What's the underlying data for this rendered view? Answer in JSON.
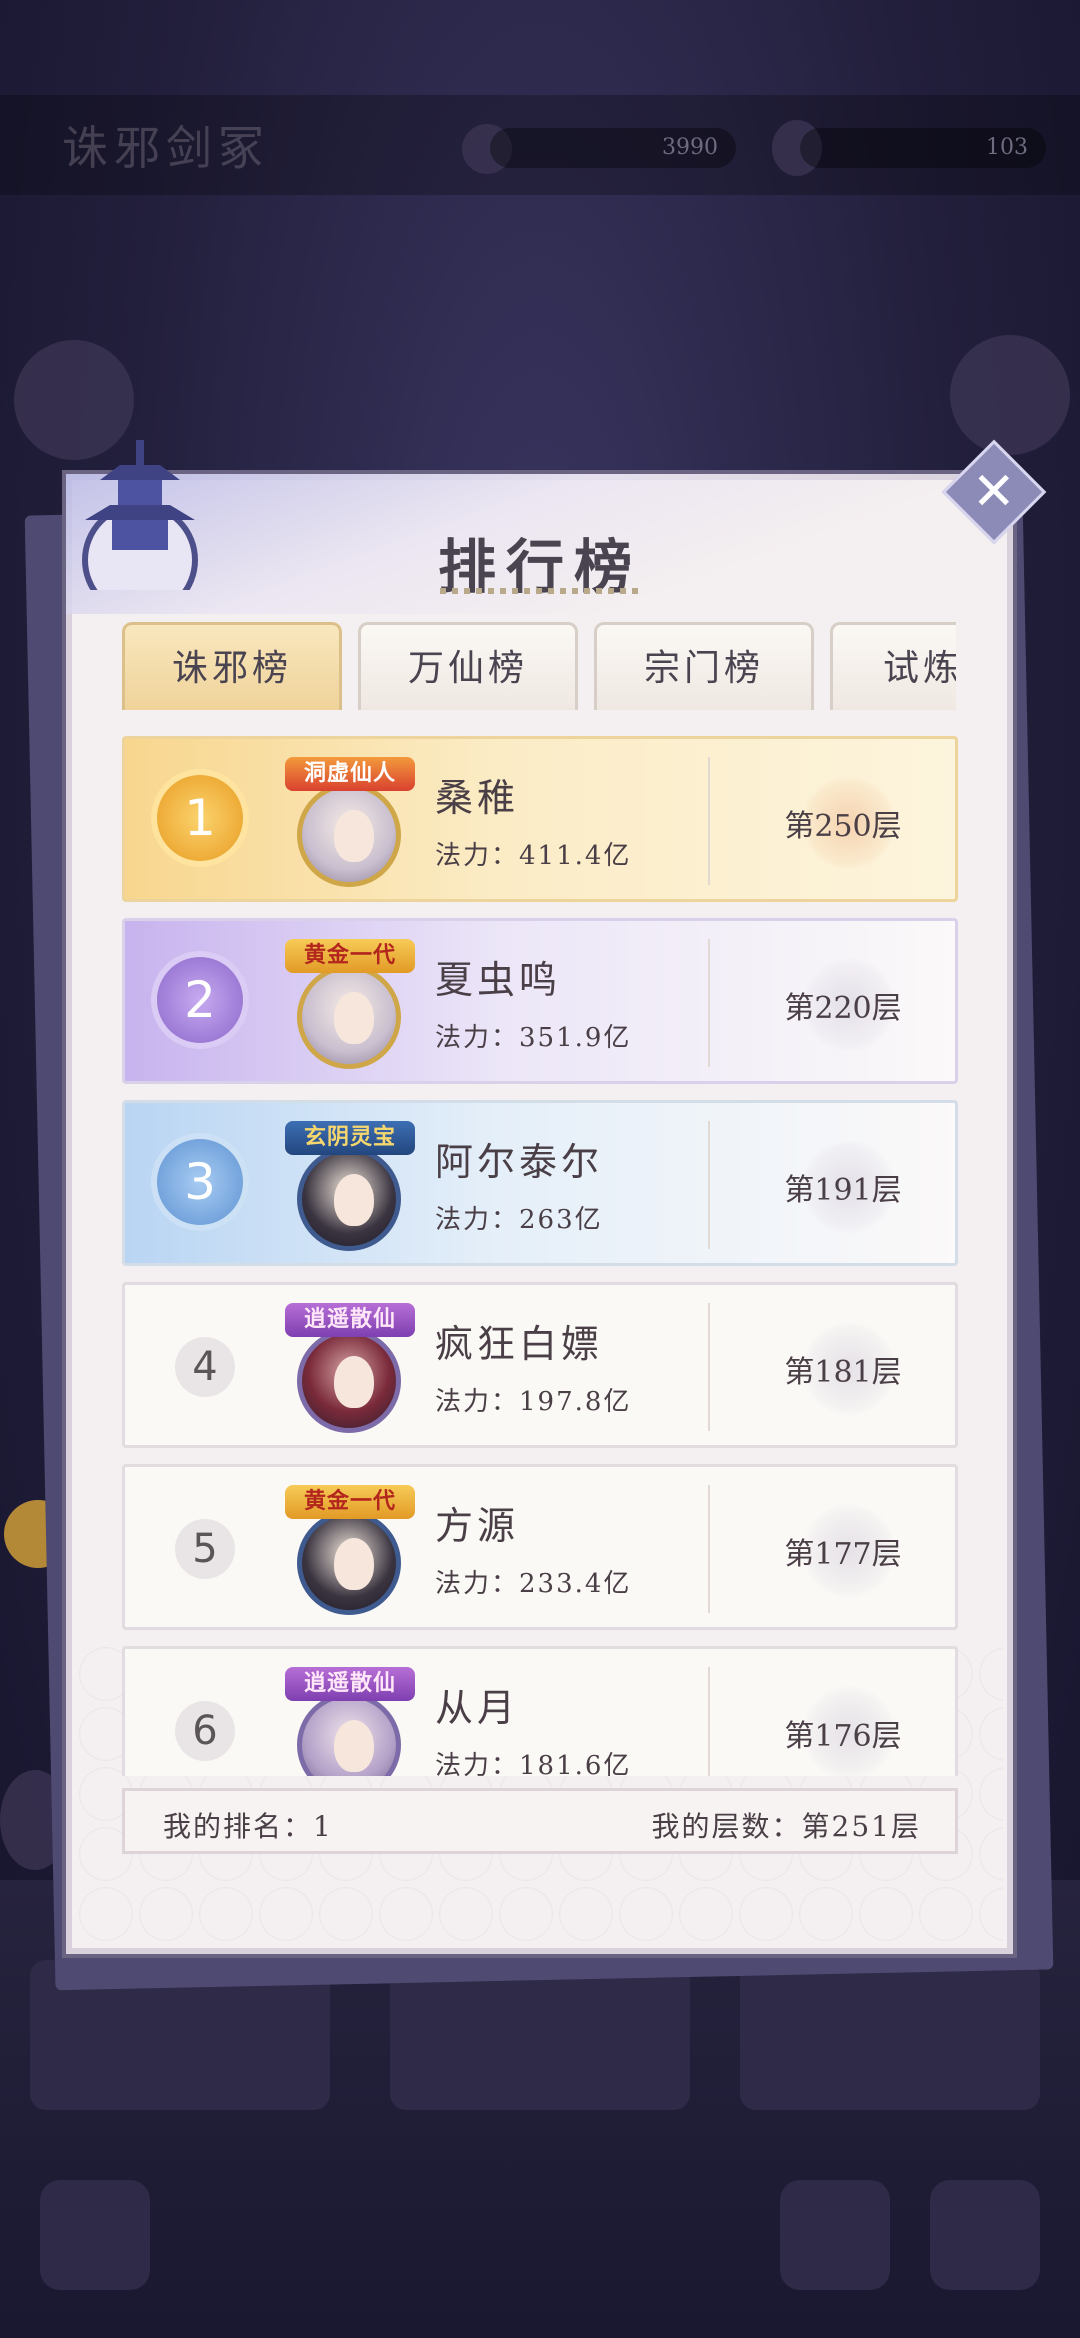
{
  "background": {
    "title": "诛邪剑冢",
    "resource_1": "3990",
    "resource_2": "103"
  },
  "panel": {
    "title": "排行榜",
    "close_label": "✕"
  },
  "tabs": [
    {
      "label": "诛邪榜",
      "active": true
    },
    {
      "label": "万仙榜",
      "active": false
    },
    {
      "label": "宗门榜",
      "active": false
    },
    {
      "label": "试炼",
      "active": false
    }
  ],
  "rows": [
    {
      "rank": "1",
      "badge": "洞虚仙人",
      "name": "桑稚",
      "power": "法力：411.4亿",
      "floor": "第250层"
    },
    {
      "rank": "2",
      "badge": "黄金一代",
      "name": "夏虫鸣",
      "power": "法力：351.9亿",
      "floor": "第220层"
    },
    {
      "rank": "3",
      "badge": "玄阴灵宝",
      "name": "阿尔泰尔",
      "power": "法力：263亿",
      "floor": "第191层"
    },
    {
      "rank": "4",
      "badge": "逍遥散仙",
      "name": "疯狂白嫖",
      "power": "法力：197.8亿",
      "floor": "第181层"
    },
    {
      "rank": "5",
      "badge": "黄金一代",
      "name": "方源",
      "power": "法力：233.4亿",
      "floor": "第177层"
    },
    {
      "rank": "6",
      "badge": "逍遥散仙",
      "name": "从月",
      "power": "法力：181.6亿",
      "floor": "第176层"
    }
  ],
  "footer": {
    "my_rank": "我的排名：1",
    "my_floor": "我的层数：第251层"
  },
  "colors": {
    "gold": "#efd39a",
    "purple": "#9c7bd6",
    "blue": "#74a4dc",
    "frame": "#6a6482"
  }
}
